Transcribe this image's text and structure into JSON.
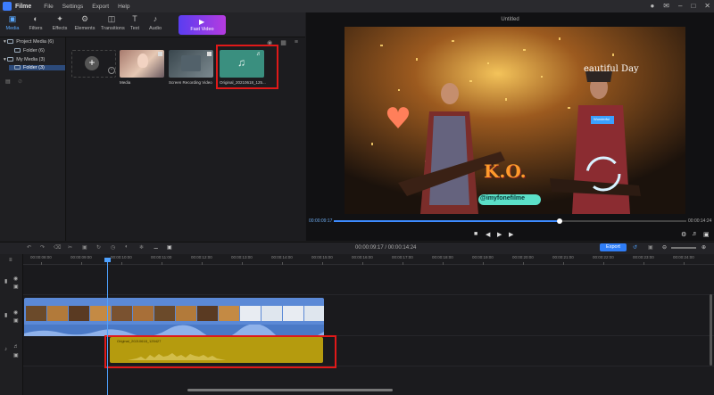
{
  "app": {
    "name": "Filme",
    "menu": [
      "File",
      "Settings",
      "Export",
      "Help"
    ],
    "icons": [
      "user-icon",
      "mail-icon",
      "minimize-icon",
      "maximize-icon",
      "close-icon"
    ]
  },
  "toolbar": {
    "tabs": [
      {
        "label": "Media",
        "icon": "media-icon"
      },
      {
        "label": "Filters",
        "icon": "filters-icon"
      },
      {
        "label": "Effects",
        "icon": "effects-icon"
      },
      {
        "label": "Elements",
        "icon": "elements-icon"
      },
      {
        "label": "Transitions",
        "icon": "transitions-icon"
      },
      {
        "label": "Text",
        "icon": "text-icon"
      },
      {
        "label": "Audio",
        "icon": "audio-icon"
      }
    ],
    "fast_video": "Fast Video"
  },
  "sidebar": {
    "project_media": "Project Media (6)",
    "project_folder": "Folder (6)",
    "my_media": "My Media (3)",
    "my_folder": "Folder (3)"
  },
  "media": {
    "items": [
      {
        "label": "Media"
      },
      {
        "label": "Screen Recording Video"
      },
      {
        "label": "Original_20210618_125..."
      }
    ]
  },
  "preview": {
    "title": "Untitled",
    "overlay_text_1": "eautiful Day",
    "overlay_text_2": "K.O.",
    "overlay_text_3": "@imyfonefilme",
    "overlay_text_4": "Wonderful",
    "current_time": "00:00:09:17",
    "total_time": "00:00:14:24",
    "progress": 0.64
  },
  "timeline": {
    "time_display": "00:00:09:17 / 00:00:14:24",
    "export_label": "Export",
    "ruler": [
      "00:00:08:00",
      "00:00:09:00",
      "00:00:10:00",
      "00:00:11:00",
      "00:00:12:00",
      "00:00:13:00",
      "00:00:14:00",
      "00:00:15:00",
      "00:00:16:00",
      "00:00:17:00",
      "00:00:18:00",
      "00:00:19:00",
      "00:00:20:00",
      "00:00:21:00",
      "00:00:22:00",
      "00:00:23:00",
      "00:00:24:00"
    ],
    "audio_clip_label": "Original_20210618_125427"
  },
  "colors": {
    "accent": "#3d8bff",
    "audio_clip": "#b59b0e",
    "video_clip": "#5b89d6",
    "highlight": "#e01919"
  }
}
